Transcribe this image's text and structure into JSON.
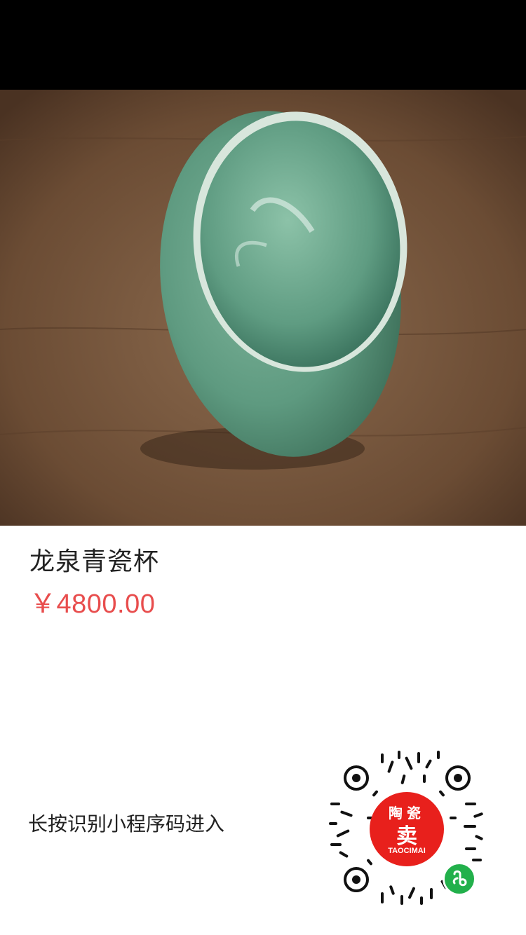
{
  "product": {
    "title": "龙泉青瓷杯",
    "price": "￥4800.00",
    "image": "celadon-cup-photo"
  },
  "footer": {
    "hint": "长按识别小程序码进入"
  },
  "qrcode": {
    "badge_line1": "陶瓷",
    "badge_line2": "卖",
    "badge_line3": "TAOCIMAI",
    "icon": "miniprogram-icon"
  },
  "colors": {
    "price": "#e84d4d",
    "badge": "#e8201c",
    "miniprogram": "#22b04b"
  }
}
